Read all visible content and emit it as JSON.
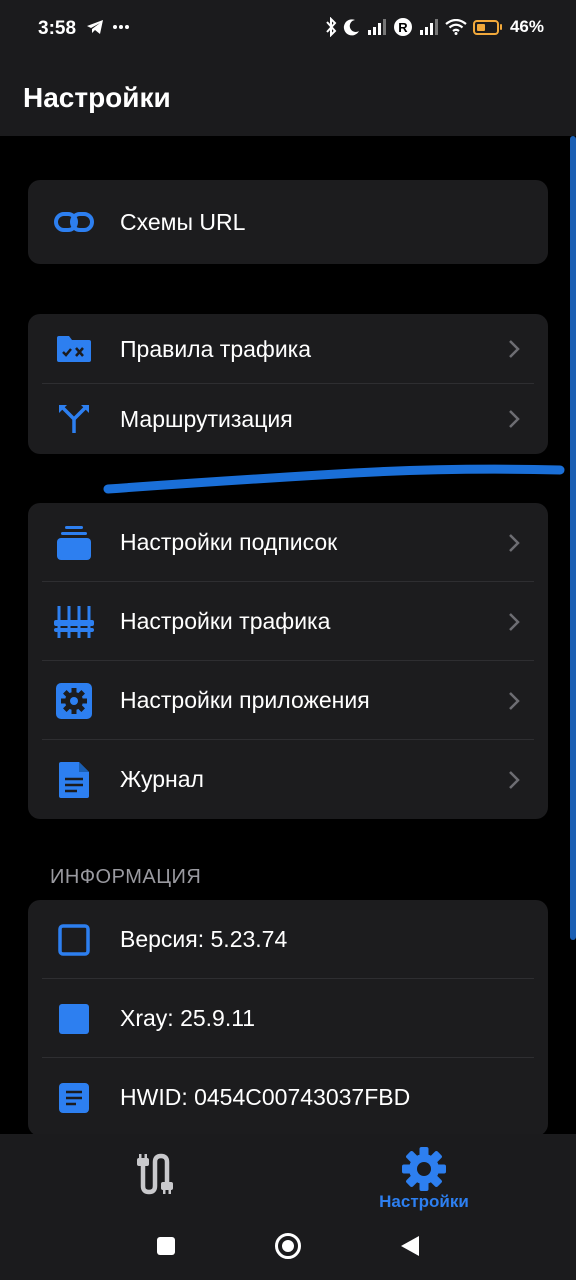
{
  "status_bar": {
    "time": "3:58",
    "battery_percent": "46%",
    "battery_level": 0.46,
    "icons": [
      "telegram-icon",
      "more-dots-icon",
      "bluetooth-icon",
      "moon-icon",
      "signal-icon",
      "r-circle-icon",
      "signal-icon",
      "wifi-icon",
      "battery-icon"
    ]
  },
  "header": {
    "title": "Настройки"
  },
  "groups": [
    {
      "items": [
        {
          "label": "Схемы URL",
          "icon": "link-icon",
          "chevron": false
        }
      ]
    },
    {
      "items": [
        {
          "label": "Правила трафика",
          "icon": "folder-rules-icon",
          "chevron": true
        },
        {
          "label": "Маршрутизация",
          "icon": "routing-split-icon",
          "chevron": true
        }
      ]
    },
    {
      "items": [
        {
          "label": "Настройки подписок",
          "icon": "subscriptions-stack-icon",
          "chevron": true
        },
        {
          "label": "Настройки трафика",
          "icon": "equalizer-sliders-icon",
          "chevron": true
        },
        {
          "label": "Настройки приложения",
          "icon": "gear-icon",
          "chevron": true
        },
        {
          "label": "Журнал",
          "icon": "document-log-icon",
          "chevron": true
        }
      ]
    }
  ],
  "info": {
    "header": "ИНФОРМАЦИЯ",
    "items": [
      {
        "label": "Версия: 5.23.74",
        "icon": "square-outline-icon"
      },
      {
        "label": "Xray: 25.9.11",
        "icon": "square-filled-icon"
      },
      {
        "label": "HWID: 0454C00743037FBD",
        "icon": "document-lines-icon"
      }
    ]
  },
  "bottom_nav": {
    "tabs": [
      {
        "label": "",
        "icon": "route-connection-icon",
        "active": false
      },
      {
        "label": "Настройки",
        "icon": "gear-icon",
        "active": true
      }
    ]
  },
  "colors": {
    "accent": "#2d7ff0",
    "card": "#1c1c1e",
    "bar": "#1b1b1d",
    "background": "#000000"
  }
}
